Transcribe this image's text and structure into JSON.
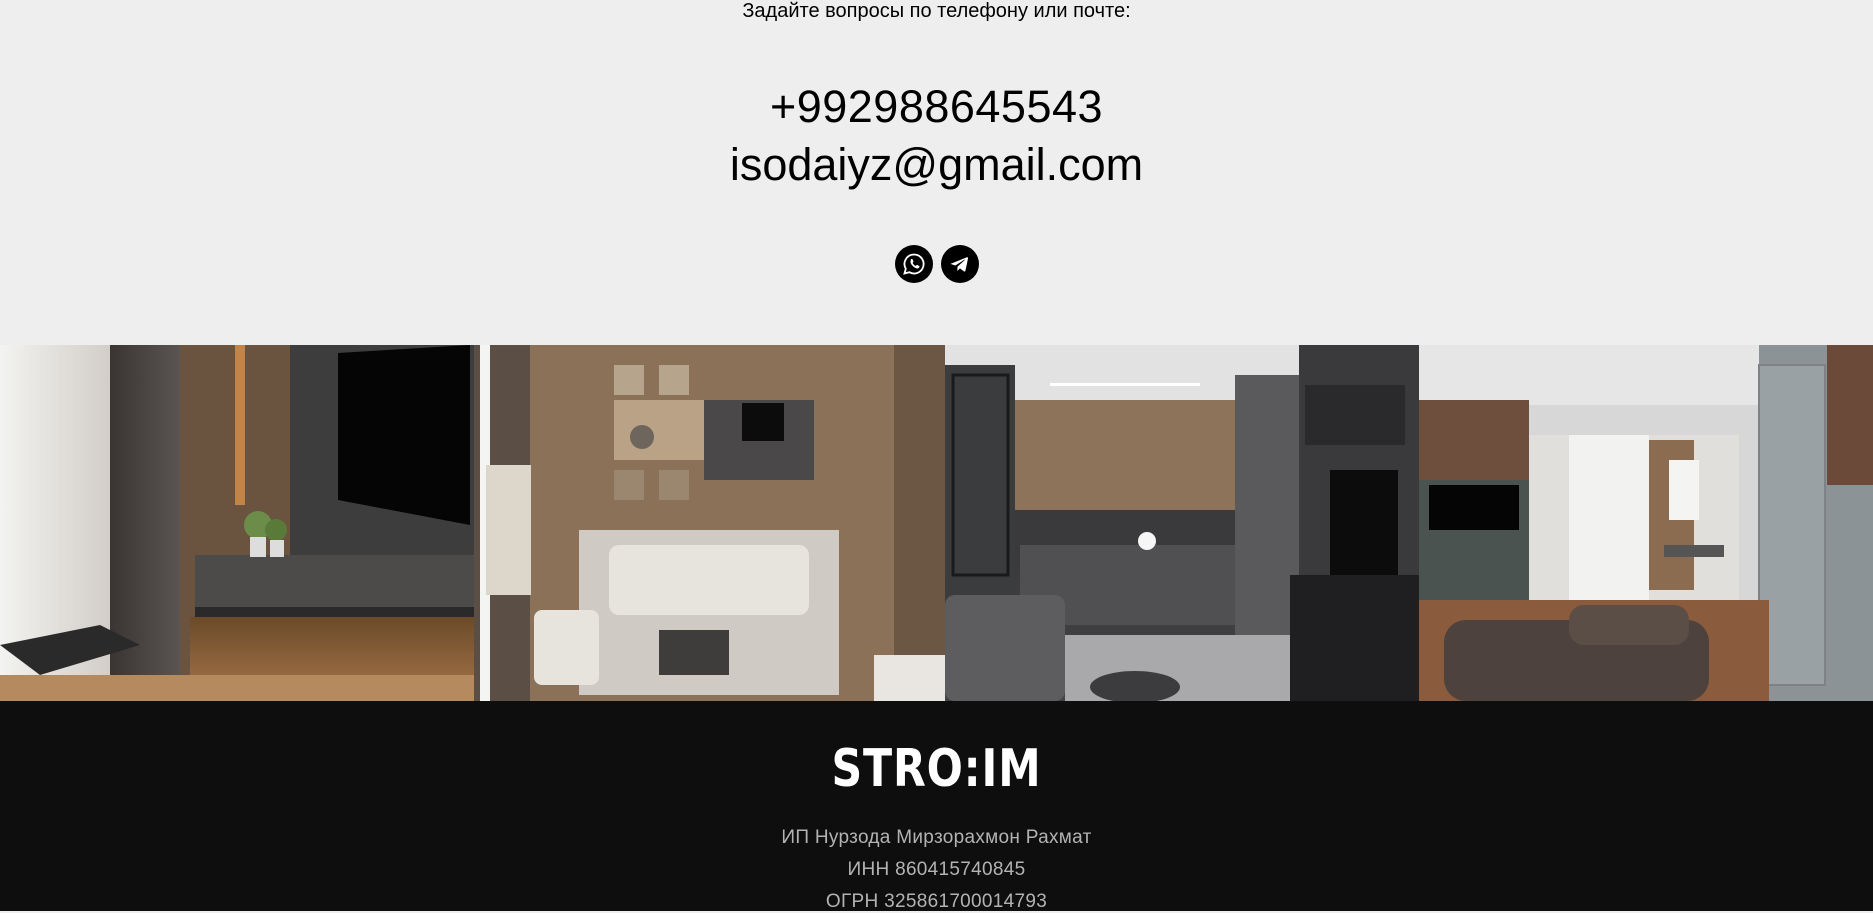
{
  "contact": {
    "lead": "Задайте вопросы по телефону или почте:",
    "phone": "+992988645543",
    "email": "isodaiyz@gmail.com",
    "socials": [
      {
        "icon": "whatsapp-icon"
      },
      {
        "icon": "telegram-icon"
      }
    ]
  },
  "gallery": {
    "photos": [
      {
        "subject": "living-room-tv-wall"
      },
      {
        "subject": "living-dining-top-view"
      },
      {
        "subject": "kitchen-living-room"
      },
      {
        "subject": "living-room-sofa"
      }
    ]
  },
  "footer": {
    "logo": "STRO:IM",
    "company": "ИП Нурзода Мирзорахмон Рахмат",
    "inn": "ИНН 860415740845",
    "ogrn": "ОГРН 325861700014793"
  },
  "colors": {
    "background": "#eeeeee",
    "footer_bg": "#0e0e0f",
    "footer_text": "#b3b3b3",
    "accent": "#000000"
  }
}
